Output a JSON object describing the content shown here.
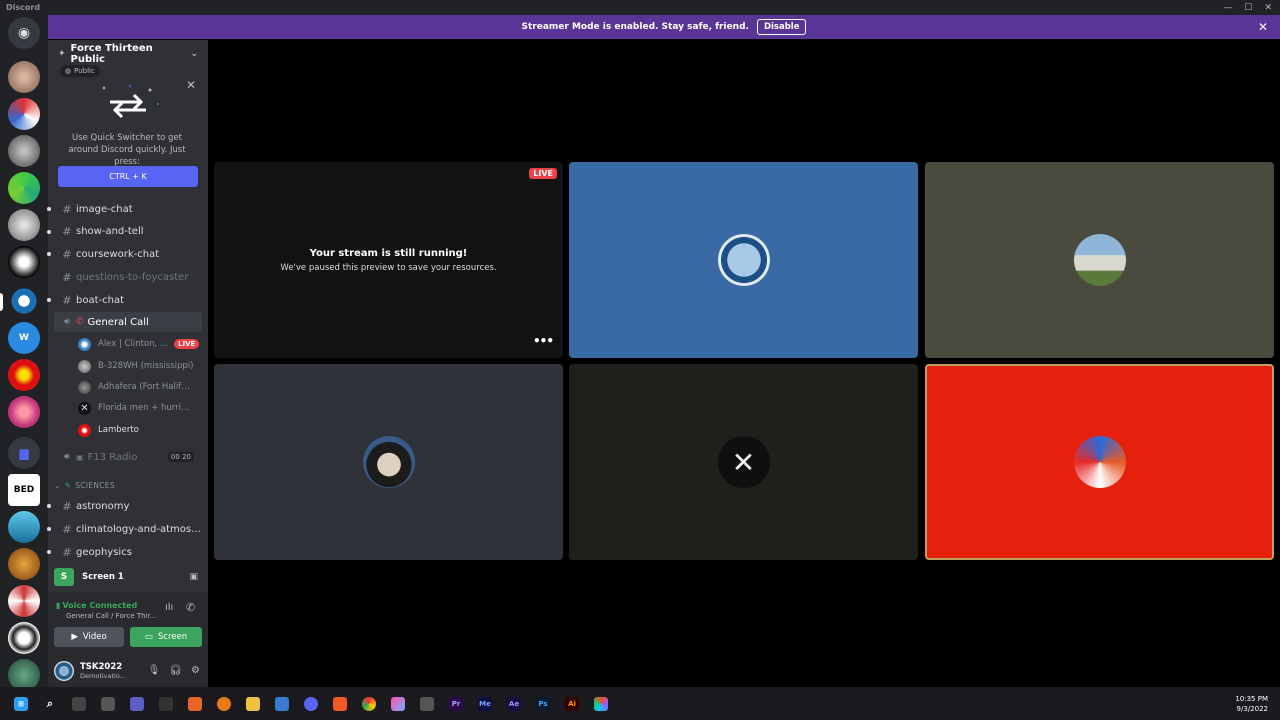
{
  "app": {
    "name": "Discord"
  },
  "banner": {
    "message": "Streamer Mode is enabled. Stay safe, friend.",
    "disable_label": "Disable"
  },
  "server": {
    "name": "Force Thirteen Public",
    "badge": "Public"
  },
  "quick_switcher": {
    "text": "Use Quick Switcher to get around Discord quickly. Just press:",
    "shortcut": "CTRL + K"
  },
  "channels": [
    {
      "name": "image-chat",
      "type": "text"
    },
    {
      "name": "show-and-tell",
      "type": "text"
    },
    {
      "name": "coursework-chat",
      "type": "text"
    },
    {
      "name": "questions-to-foycaster",
      "type": "text",
      "muted": true
    },
    {
      "name": "boat-chat",
      "type": "text"
    },
    {
      "name": "General Call",
      "type": "voice",
      "active": true
    }
  ],
  "voice_users": [
    {
      "name": "Alex | Clinton, ...",
      "live": "LIVE"
    },
    {
      "name": "B-328WH (mississippi)"
    },
    {
      "name": "Adhafera (Fort Halifax, P..."
    },
    {
      "name": "Florida men + hurricane ..."
    },
    {
      "name": "Lamberto"
    }
  ],
  "radio_channel": {
    "name": "F13 Radio",
    "count_a": "00",
    "count_b": "20"
  },
  "category": {
    "name": "SCIENCES"
  },
  "science_channels": [
    {
      "name": "astronomy"
    },
    {
      "name": "climatology-and-atmos..."
    },
    {
      "name": "geophysics"
    }
  ],
  "screen_share": {
    "label": "Screen 1",
    "icon_letter": "S"
  },
  "voice_panel": {
    "status": "Voice Connected",
    "location": "General Call / Force Thir...",
    "video_label": "Video",
    "screen_label": "Screen"
  },
  "user": {
    "name": "TSK2022",
    "status": "Demotivatio..."
  },
  "stream": {
    "title": "Your stream is still running!",
    "subtitle": "We've paused this preview to save your resources.",
    "live_badge": "LIVE"
  },
  "colors": {
    "accent": "#5865f2",
    "banner": "#593695",
    "live": "#ed4245",
    "connected": "#3ba55d",
    "tile_blue": "#3a6aa3",
    "tile_olive": "#4a4a3f",
    "tile_slate": "#2f3238",
    "tile_dark": "#1e201c",
    "tile_red": "#e5200d"
  },
  "clock": {
    "time": "10:35 PM",
    "date": "9/3/2022"
  }
}
